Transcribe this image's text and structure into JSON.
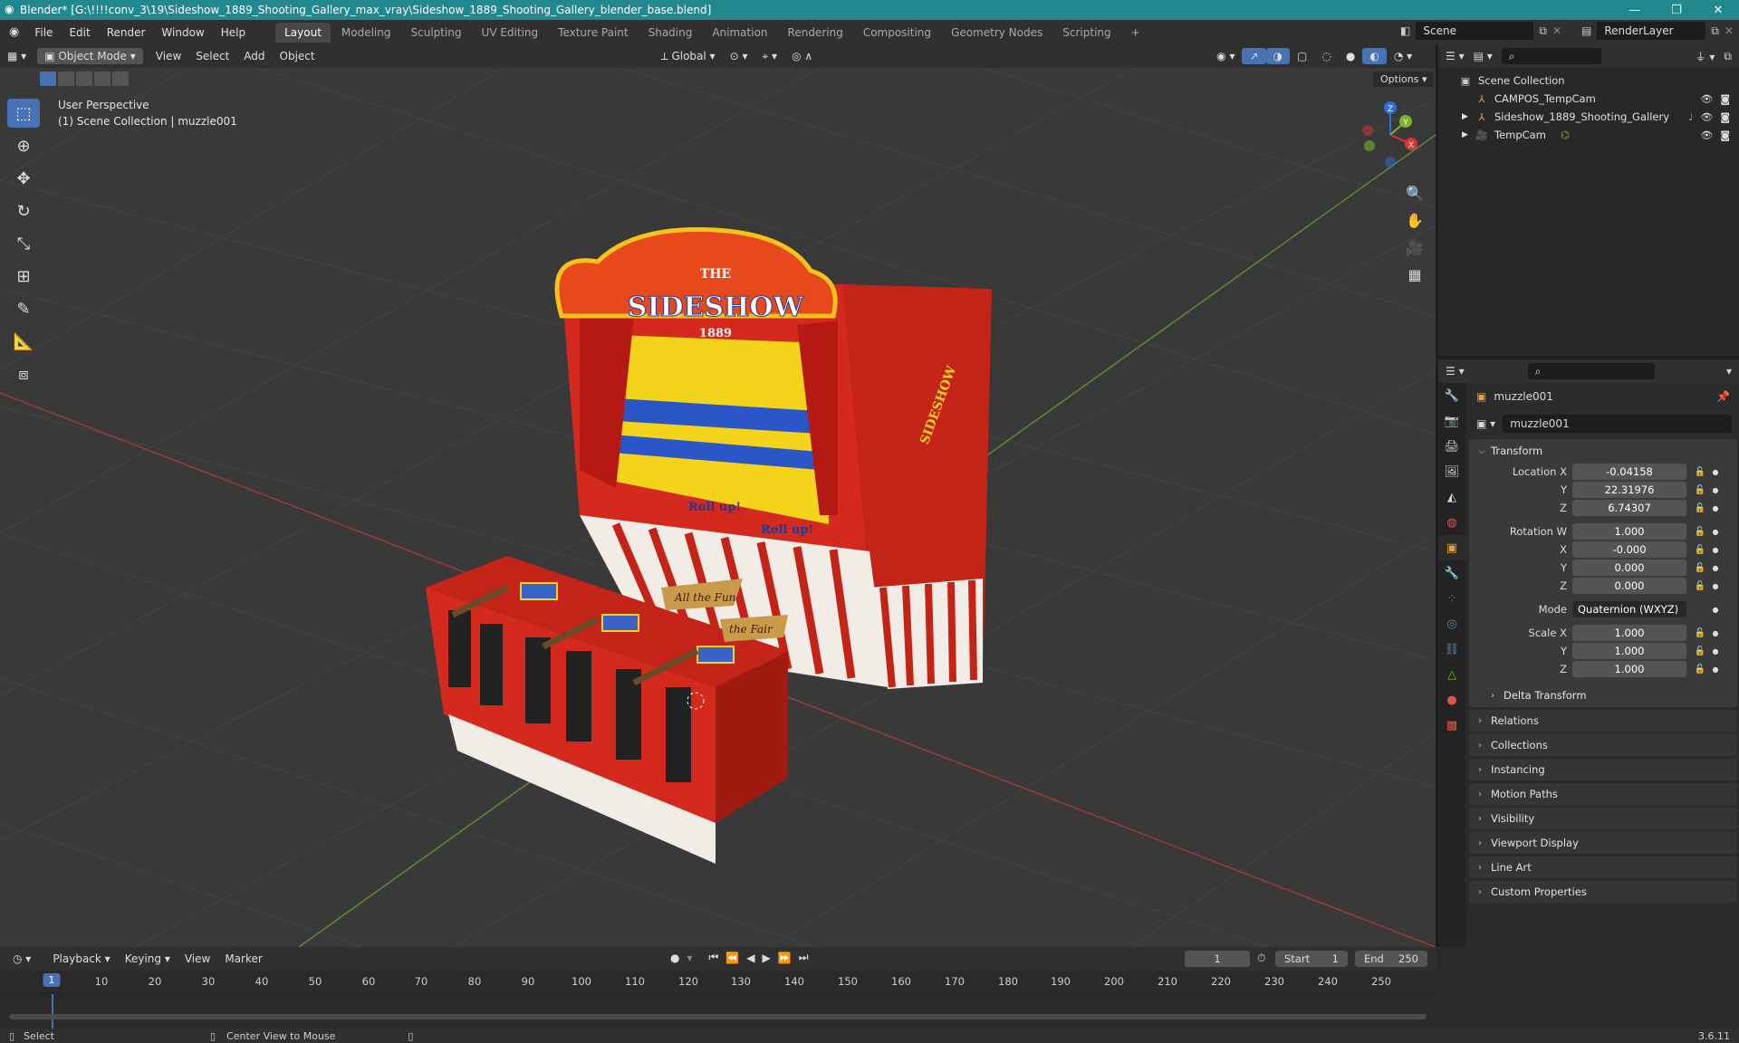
{
  "window": {
    "title": "Blender* [G:\\!!!!conv_3\\19\\Sideshow_1889_Shooting_Gallery_max_vray\\Sideshow_1889_Shooting_Gallery_blender_base.blend]"
  },
  "menus": [
    "File",
    "Edit",
    "Render",
    "Window",
    "Help"
  ],
  "workspaces": [
    "Layout",
    "Modeling",
    "Sculpting",
    "UV Editing",
    "Texture Paint",
    "Shading",
    "Animation",
    "Rendering",
    "Compositing",
    "Geometry Nodes",
    "Scripting"
  ],
  "scene": {
    "name": "Scene",
    "render_layer": "RenderLayer"
  },
  "viewport": {
    "mode": "Object Mode",
    "menus": [
      "View",
      "Select",
      "Add",
      "Object"
    ],
    "orientation": "Global",
    "options_label": "Options",
    "overlay_line1": "User Perspective",
    "overlay_line2": "(1) Scene Collection | muzzle001",
    "gizmo_axes": {
      "x": "X",
      "y": "Y",
      "z": "Z"
    }
  },
  "outliner": {
    "root": "Scene Collection",
    "items": [
      {
        "name": "CAMPOS_TempCam"
      },
      {
        "name": "Sideshow_1889_Shooting_Gallery"
      },
      {
        "name": "TempCam"
      }
    ]
  },
  "properties": {
    "object_name": "muzzle001",
    "data_name": "muzzle001",
    "transform_title": "Transform",
    "location": {
      "label_x": "Location X",
      "label_y": "Y",
      "label_z": "Z",
      "x": "-0.04158",
      "y": "22.31976",
      "z": "6.74307"
    },
    "rotation": {
      "label_w": "Rotation W",
      "label_x": "X",
      "label_y": "Y",
      "label_z": "Z",
      "w": "1.000",
      "x": "-0.000",
      "y": "0.000",
      "z": "0.000"
    },
    "mode_label": "Mode",
    "mode_value": "Quaternion (WXYZ)",
    "scale": {
      "label_x": "Scale X",
      "label_y": "Y",
      "label_z": "Z",
      "x": "1.000",
      "y": "1.000",
      "z": "1.000"
    },
    "delta_transform": "Delta Transform",
    "panels": [
      "Relations",
      "Collections",
      "Instancing",
      "Motion Paths",
      "Visibility",
      "Viewport Display",
      "Line Art",
      "Custom Properties"
    ]
  },
  "timeline": {
    "menus": [
      "Playback",
      "Keying",
      "View",
      "Marker"
    ],
    "current_frame": "1",
    "start_label": "Start",
    "start": "1",
    "end_label": "End",
    "end": "250",
    "ticks": [
      "10",
      "20",
      "30",
      "40",
      "50",
      "60",
      "70",
      "80",
      "90",
      "100",
      "110",
      "120",
      "130",
      "140",
      "150",
      "160",
      "170",
      "180",
      "190",
      "200",
      "210",
      "220",
      "230",
      "240",
      "250"
    ]
  },
  "scene_text": {
    "sign_the": "THE",
    "sign_main": "SIDESHOW",
    "sign_year": "1889",
    "side_sign": "SIDESHOW",
    "banner1": "All the Fun",
    "banner2": "the Fair",
    "roll1": "Roll up!",
    "roll2": "Roll up!"
  },
  "statusbar": {
    "select": "Select",
    "center": "Center View to Mouse",
    "version": "3.6.11"
  },
  "colors": {
    "accent": "#4772b3",
    "titlebar": "#21898e",
    "booth_red": "#d42a1e",
    "booth_yellow": "#f4d31b"
  }
}
